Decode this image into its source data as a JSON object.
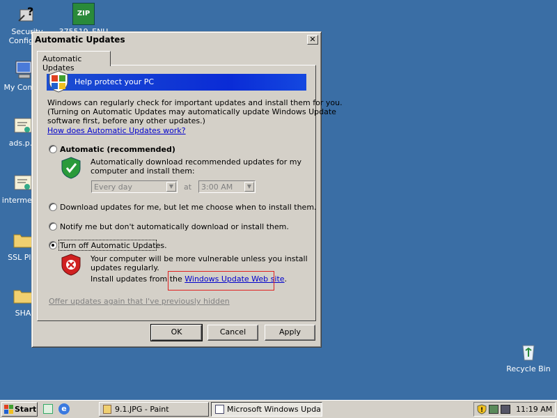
{
  "desktop": {
    "icons": [
      {
        "label": "Security\nConfigu..."
      },
      {
        "label": "375519_ENU"
      },
      {
        "label": "My Com..."
      },
      {
        "label": "ads.p..."
      },
      {
        "label": "intermed..."
      },
      {
        "label": "SSL Pl..."
      },
      {
        "label": "SHA"
      },
      {
        "label": "Recycle Bin"
      }
    ],
    "zip_text": "ZIP"
  },
  "dialog": {
    "title": "Automatic Updates",
    "close_glyph": "✕",
    "tab_label": "Automatic Updates",
    "banner_text": "Help protect your PC",
    "intro_lines": [
      "Windows can regularly check for important updates and install them for you.",
      "(Turning on Automatic Updates may automatically update Windows Update",
      "software first, before any other updates.)"
    ],
    "how_link": "How does Automatic Updates work?",
    "option_automatic": "Automatic (recommended)",
    "auto_desc_lines": [
      "Automatically download recommended updates for my",
      "computer and install them:"
    ],
    "day_value": "Every day",
    "at_label": "at",
    "time_value": "3:00 AM",
    "option_download": "Download updates for me, but let me choose when to install them.",
    "option_notify": "Notify me but don't automatically download or install them.",
    "option_off": "Turn off Automatic Updates.",
    "off_desc_lines": [
      "Your computer will be more vulnerable unless you install",
      "updates regularly."
    ],
    "install_from": "Install updates from the ",
    "wu_link": "Windows Update Web site",
    "period": ".",
    "offer_again": "Offer updates again that I've previously hidden",
    "ok_label": "OK",
    "cancel_label": "Cancel",
    "apply_label": "Apply",
    "selected_option": "off"
  },
  "taskbar": {
    "start_label": "Start",
    "tasks": [
      {
        "label": "9.1.JPG - Paint"
      },
      {
        "label": "Microsoft Windows Upda..."
      }
    ],
    "clock": "11:19 AM"
  }
}
